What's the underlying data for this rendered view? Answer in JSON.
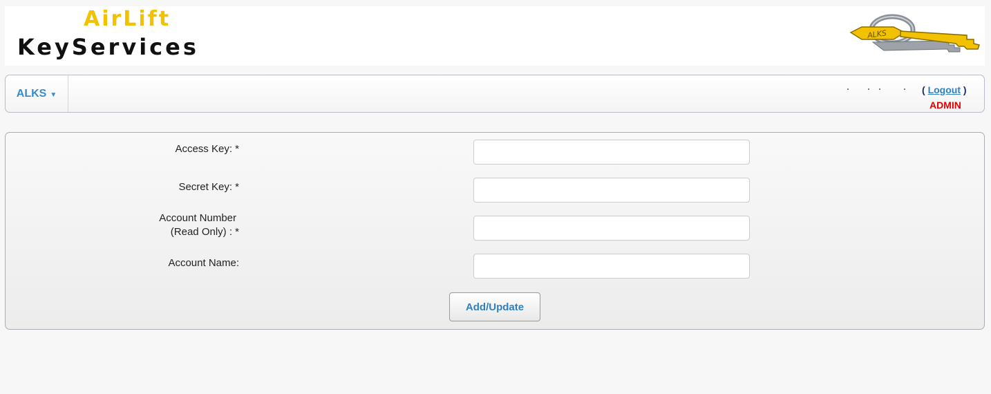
{
  "header": {
    "brand_line1": "AirLift",
    "brand_line2": "KeyServices",
    "logo_text": "ALKS"
  },
  "navbar": {
    "menu_label": "ALKS",
    "menu_caret": "▼",
    "logout_open": "( ",
    "logout_label": "Logout",
    "logout_close": " )",
    "role": "ADMIN"
  },
  "form": {
    "fields": [
      {
        "label": "Access Key: *",
        "value": ""
      },
      {
        "label": "Secret Key: *",
        "value": ""
      },
      {
        "label_line1": "Account Number",
        "label_line2": "(Read Only) : *",
        "value": ""
      },
      {
        "label": "Account Name:",
        "value": ""
      }
    ],
    "submit_label": "Add/Update"
  },
  "colors": {
    "brand_yellow": "#f2c200",
    "link_blue": "#2f7fc1",
    "admin_red": "#e00000"
  },
  "icons": {
    "logo": "key-icon",
    "menu_caret": "caret-down-icon"
  }
}
